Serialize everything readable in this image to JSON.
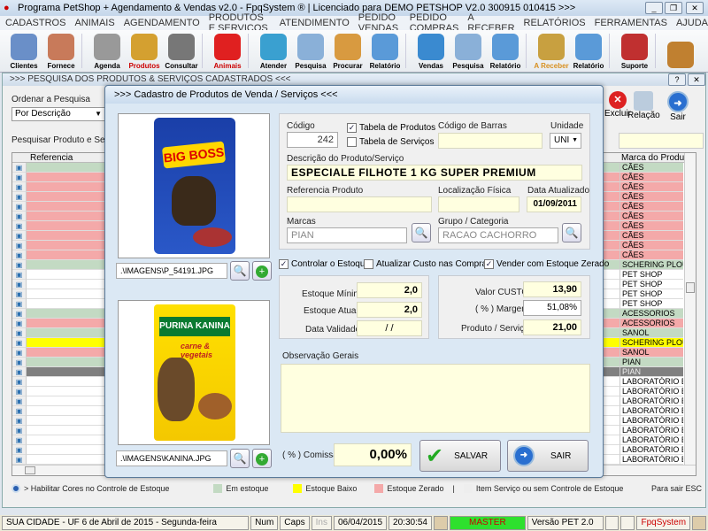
{
  "window": {
    "title": "Programa PetShop + Agendamento & Vendas v2.0 - FpqSystem ® | Licenciado para  DEMO PETSHOP V2.0 300915 010415 >>>"
  },
  "menu": [
    "CADASTROS",
    "ANIMAIS",
    "AGENDAMENTO",
    "PRODUTOS E SERVIÇOS",
    "ATENDIMENTO",
    "PEDIDO VENDAS",
    "PEDIDO COMPRAS",
    "A RECEBER",
    "RELATÓRIOS",
    "FERRAMENTAS",
    "AJUDA"
  ],
  "toolbar": [
    {
      "label": "Clientes",
      "icon": "clients-icon",
      "color": "#6a8fc8"
    },
    {
      "label": "Fornece",
      "icon": "supplier-icon",
      "color": "#c87a5a"
    },
    {
      "label": "Agenda",
      "icon": "calendar-clock-icon",
      "color": "#999"
    },
    {
      "label": "Produtos",
      "icon": "boxes-icon",
      "color": "#d4a030"
    },
    {
      "label": "Consultar",
      "icon": "barcode-icon",
      "color": "#777"
    },
    {
      "label": "Animais",
      "icon": "paw-icon",
      "color": "#e02020"
    },
    {
      "label": "Atender",
      "icon": "paw-plus-icon",
      "color": "#3aa0d0"
    },
    {
      "label": "Pesquisa",
      "icon": "search-doc-icon",
      "color": "#8ab0d8"
    },
    {
      "label": "Procurar",
      "icon": "file-box-icon",
      "color": "#d89a40"
    },
    {
      "label": "Relatório",
      "icon": "printer-icon",
      "color": "#5a9ad8"
    },
    {
      "label": "Vendas",
      "icon": "monitor-icon",
      "color": "#3a8ad0"
    },
    {
      "label": "Pesquisa",
      "icon": "search-doc-icon",
      "color": "#8ab0d8"
    },
    {
      "label": "Relatório",
      "icon": "printer-icon",
      "color": "#5a9ad8"
    },
    {
      "label": "A Receber",
      "icon": "money-icon",
      "color": "#c8a040"
    },
    {
      "label": "Relatório",
      "icon": "printer-icon",
      "color": "#5a9ad8"
    },
    {
      "label": "Suporte",
      "icon": "support-icon",
      "color": "#c03030"
    },
    {
      "label": "",
      "icon": "exit-icon",
      "color": "#c08030"
    }
  ],
  "search_window": {
    "title": ">>> PESQUISA DOS PRODUTOS & SERVIÇOS CADASTRADOS <<<",
    "order_label": "Ordenar a Pesquisa",
    "order_value": "Por Descrição",
    "search_label": "Pesquisar Produto e Serviço",
    "col_ref": "Referencia",
    "col_brand": "Marca do Produto",
    "btn_excluir": "Excluir",
    "btn_relacao": "Relação",
    "btn_sair": "Sair",
    "rows": [
      {
        "brand": "CÃES",
        "c": "g"
      },
      {
        "brand": "CÃES",
        "c": "p"
      },
      {
        "brand": "CÃES",
        "c": "p"
      },
      {
        "brand": "CÃES",
        "c": "p"
      },
      {
        "brand": "CÃES",
        "c": "p"
      },
      {
        "brand": "CÃES",
        "c": "p"
      },
      {
        "brand": "CÃES",
        "c": "p"
      },
      {
        "brand": "CÃES",
        "c": "p"
      },
      {
        "brand": "CÃES",
        "c": "p"
      },
      {
        "brand": "CÃES",
        "c": "p"
      },
      {
        "brand": "SCHERING PLOUGH",
        "c": "g"
      },
      {
        "brand": "PET SHOP",
        "c": "w"
      },
      {
        "brand": "PET SHOP",
        "c": "w"
      },
      {
        "brand": "PET SHOP",
        "c": "w"
      },
      {
        "brand": "PET SHOP",
        "c": "w"
      },
      {
        "brand": "ACESSORIOS",
        "c": "g"
      },
      {
        "brand": "ACESSORIOS",
        "c": "p"
      },
      {
        "brand": "SANOL",
        "c": "g"
      },
      {
        "brand": "SCHERING PLOUGH",
        "c": "y"
      },
      {
        "brand": "SANOL",
        "c": "p"
      },
      {
        "brand": "PIAN",
        "c": "g"
      },
      {
        "brand": "PIAN",
        "c": "s"
      },
      {
        "brand": "LABORATÓRIO ES",
        "c": "w"
      },
      {
        "brand": "LABORATÓRIO ES",
        "c": "w"
      },
      {
        "brand": "LABORATÓRIO ES",
        "c": "w"
      },
      {
        "brand": "LABORATÓRIO ES",
        "c": "w"
      },
      {
        "brand": "LABORATÓRIO ES",
        "c": "w"
      },
      {
        "brand": "LABORATÓRIO ES",
        "c": "w"
      },
      {
        "brand": "LABORATÓRIO ES",
        "c": "w"
      },
      {
        "brand": "LABORATÓRIO ES",
        "c": "w"
      },
      {
        "brand": "LABORATÓRIO ES",
        "c": "w"
      },
      {
        "brand": "LABORATÓRIO ES",
        "c": "w"
      }
    ],
    "legend": {
      "enable": "> Habilitar Cores no Controle de Estoque",
      "in_stock": "Em estoque",
      "low": "Estoque Baixo",
      "zero": "Estoque Zerado",
      "sep": "|",
      "service": "Item Serviço ou sem Controle de Estoque",
      "esc": "Para sair ESC"
    }
  },
  "modal": {
    "title": ">>> Cadastro de Produtos de Venda / Serviços <<<",
    "image1_path": ".\\IMAGENS\\P_54191.JPG",
    "image1_brand": "BIG BOSS",
    "image2_path": ".\\IMAGENS\\KANINA.JPG",
    "image2_brand": "PURINA KANINA",
    "image2_sub": "carne & vegetais",
    "codigo_label": "Código",
    "codigo": "242",
    "tabela_produtos": "Tabela de Produtos",
    "tabela_servicos": "Tabela de Serviços",
    "barras_label": "Código de Barras",
    "barras": "",
    "unidade_label": "Unidade",
    "unidade": "UNI",
    "descricao_label": "Descrição do Produto/Serviço",
    "descricao": "ESPECIALE FILHOTE 1 KG SUPER PREMIUM",
    "referencia_label": "Referencia Produto",
    "referencia": "",
    "localizacao_label": "Localização Física",
    "localizacao": "",
    "data_label": "Data Atualizado",
    "data": "01/09/2011",
    "marcas_label": "Marcas",
    "marcas": "PIAN",
    "grupo_label": "Grupo / Categoria",
    "grupo": "RACAO CACHORRO",
    "controlar": "Controlar o Estoque",
    "atualizar": "Atualizar Custo nas Compras",
    "vender_zerado": "Vender com Estoque Zerado",
    "estoque_min_label": "Estoque Mínimo",
    "estoque_min": "2,0",
    "estoque_atual_label": "Estoque Atual",
    "estoque_atual": "2,0",
    "validade_label": "Data Validade",
    "validade": " /  /",
    "custo_label": "Valor CUSTO",
    "custo": "13,90",
    "margem_label": "( % ) Margem",
    "margem": "51,08%",
    "preco_label": "Produto / Serviço",
    "preco": "21,00",
    "obs_label": "Observação Gerais",
    "obs": "",
    "comissao_label": "( % ) Comissão",
    "comissao": "0,00%",
    "salvar": "SALVAR",
    "sair": "SAIR"
  },
  "status": {
    "city": "SUA CIDADE - UF  6 de Abril de 2015 - Segunda-feira",
    "num": "Num",
    "caps": "Caps",
    "ins": "Ins",
    "date": "06/04/2015",
    "time": "20:30:54",
    "user": "MASTER",
    "version": "Versão PET 2.0",
    "brand": "FpqSystem"
  }
}
